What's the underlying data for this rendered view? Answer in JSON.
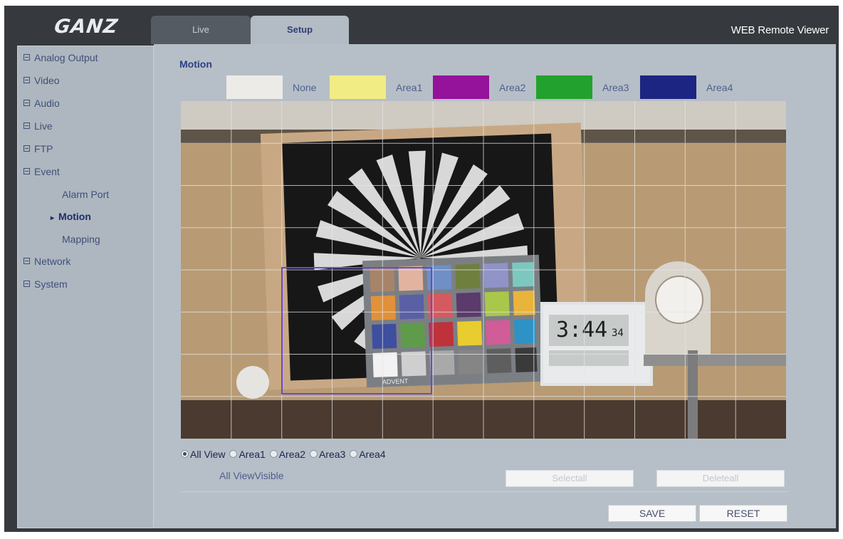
{
  "header": {
    "logo_text": "GANZ",
    "app_title": "WEB Remote Viewer",
    "tabs": [
      {
        "label": "Live"
      },
      {
        "label": "Setup"
      }
    ]
  },
  "sidebar": {
    "items": [
      {
        "label": "Analog Output"
      },
      {
        "label": "Video"
      },
      {
        "label": "Audio"
      },
      {
        "label": "Live"
      },
      {
        "label": "FTP"
      },
      {
        "label": "Event"
      },
      {
        "label": "Network"
      },
      {
        "label": "System"
      }
    ],
    "event_children": [
      {
        "label": "Alarm Port"
      },
      {
        "label": "Motion"
      },
      {
        "label": "Mapping"
      }
    ]
  },
  "main": {
    "section_title": "Motion",
    "legend": [
      {
        "label": "None",
        "color": "#ecebe7"
      },
      {
        "label": "Area1",
        "color": "#f1ed84"
      },
      {
        "label": "Area2",
        "color": "#95129a"
      },
      {
        "label": "Area3",
        "color": "#23a12e"
      },
      {
        "label": "Area4",
        "color": "#1d2582"
      }
    ],
    "camera_overlay": {
      "clock_time": "3:44",
      "clock_seconds": "34",
      "card_brand": "ADVENT"
    },
    "view_options": [
      {
        "label": "All View",
        "checked": true
      },
      {
        "label": "Area1",
        "checked": false
      },
      {
        "label": "Area2",
        "checked": false
      },
      {
        "label": "Area3",
        "checked": false
      },
      {
        "label": "Area4",
        "checked": false
      }
    ],
    "visible_label": "All ViewVisible",
    "select_all_label": "Selectall",
    "delete_all_label": "Deleteall",
    "save_label": "SAVE",
    "reset_label": "RESET"
  }
}
